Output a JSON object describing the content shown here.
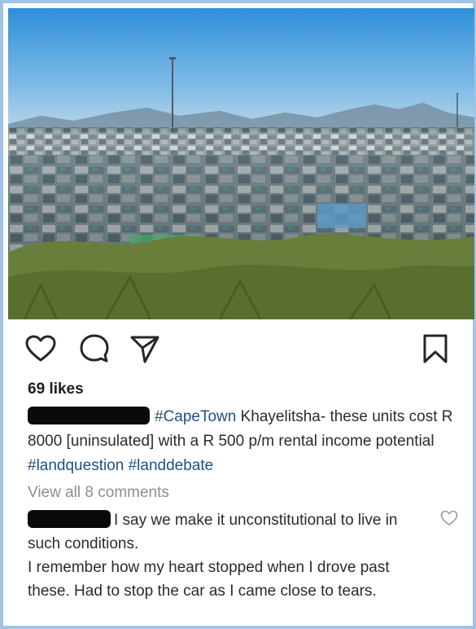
{
  "post": {
    "photo_alt": "Khayelitsha",
    "likes": "69 likes",
    "caption": {
      "tag_city": "#CapeTown",
      "text": " Khayelitsha- these units cost R 8000 [uninsulated] with a R 500 p/m rental income potential ",
      "tag_1": "#landquestion",
      "tag_2": "#landdebate"
    },
    "view_comments": "View all 8 comments",
    "comment": {
      "line_1": "I say we make it unconstitutional to live in such conditions.",
      "line_2": "I remember how my heart stopped when I drove past these. Had to stop the car as I came close to tears."
    }
  },
  "icons": {
    "like": "heart-icon",
    "comment": "comment-bubble-icon",
    "share": "paper-plane-icon",
    "save": "bookmark-icon",
    "comment_like": "heart-outline-icon"
  },
  "colors": {
    "frame": "#9fc4e6",
    "hashtag": "#1f4f86",
    "muted": "#8e8e8e",
    "text": "#2b2b2b"
  }
}
